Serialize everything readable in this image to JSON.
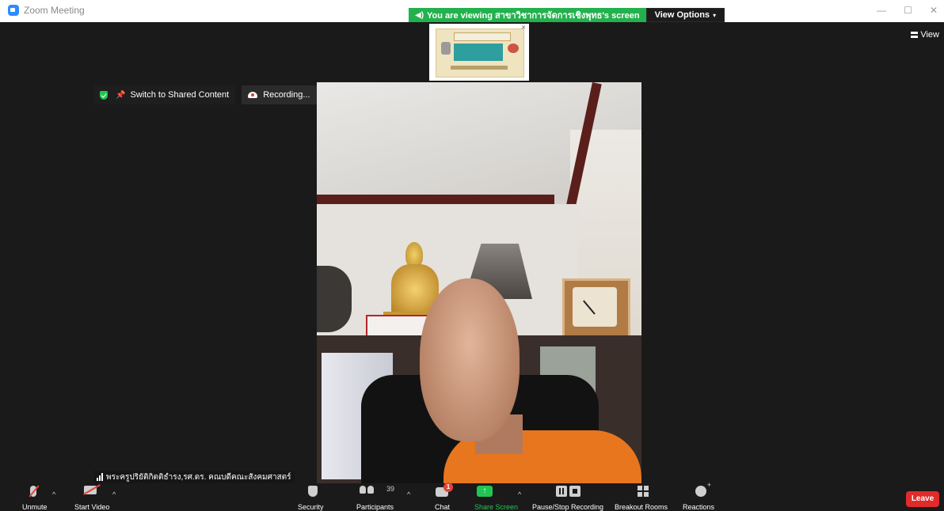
{
  "window": {
    "app_title": "Zoom Meeting",
    "controls": {
      "minimize": "—",
      "maximize": "☐",
      "close": "✕"
    }
  },
  "banner": {
    "viewing_text": "You are viewing สาขาวิชาการจัดการเชิงพุทธ's screen",
    "view_options": "View Options"
  },
  "view_toggle": {
    "label": "View"
  },
  "floating": {
    "switch_label": "Switch to Shared Content",
    "recording_label": "Recording..."
  },
  "participant": {
    "name": "พระครูปริยัติกิตติธำรง,รศ.ดร. คณบดีคณะสังคมศาสตร์"
  },
  "toolbar": {
    "unmute": "Unmute",
    "start_video": "Start Video",
    "security": "Security",
    "participants": "Participants",
    "participants_count": "39",
    "chat": "Chat",
    "chat_badge": "1",
    "share_screen": "Share Screen",
    "pause_stop_recording": "Pause/Stop Recording",
    "breakout_rooms": "Breakout Rooms",
    "reactions": "Reactions",
    "leave": "Leave"
  },
  "colors": {
    "green_accent": "#23b14d",
    "leave_red": "#e02b2b",
    "background": "#1a1a1a"
  }
}
